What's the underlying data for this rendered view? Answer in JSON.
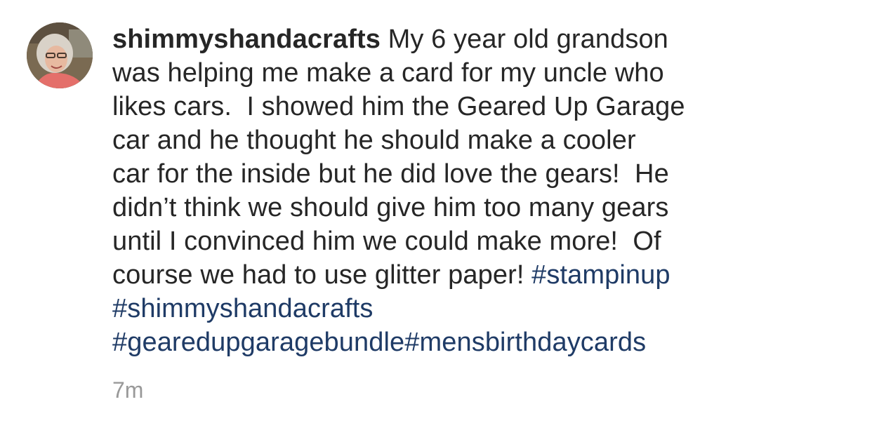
{
  "comment": {
    "username": "shimmyshandacrafts",
    "lines": [
      " My 6 year old grandson",
      "was helping me make a card for my uncle who",
      "likes cars.  I showed him the Geared Up Garage",
      "car and he thought he should make a cooler",
      "car for the inside but he did love the gears!  He",
      "didn’t think we should give him too many gears",
      "until I convinced him we could make more!  Of",
      "course we had to use glitter paper! "
    ],
    "hashtags": [
      "#stampinup",
      "#shimmyshandacrafts",
      "#gearedupgaragebundle",
      "#mensbirthdaycards"
    ],
    "timestamp": "7m"
  },
  "colors": {
    "text": "#262626",
    "hashtag": "#1f3b66",
    "timestamp": "#999999"
  }
}
